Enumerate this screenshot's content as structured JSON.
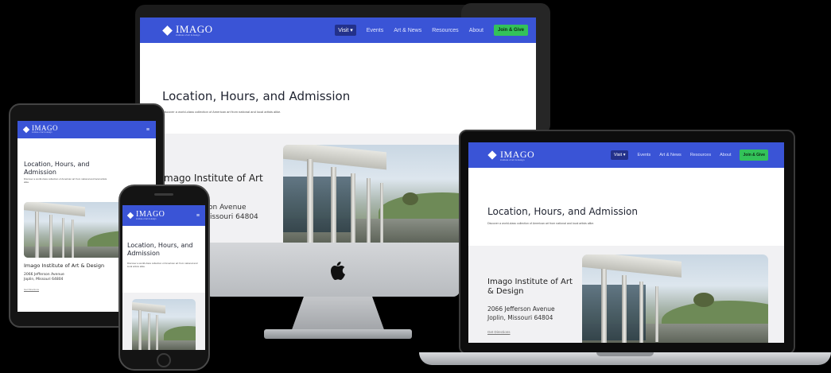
{
  "site": {
    "logo_text": "IMAGO",
    "logo_sub": "institute of art & design",
    "nav": [
      "Visit ▾",
      "Events",
      "Art & News",
      "Resources",
      "About"
    ],
    "cta": "Join & Give",
    "menu_icon": "hamburger-icon",
    "hero_title": "Location, Hours, and Admission",
    "hero_title_wrapped": [
      "Location, Hours, and",
      "Admission"
    ],
    "hero_desc": "Discover a world-class collection of American art from national and local artists alike.",
    "inst_name": "Imago Institute of Art & Design",
    "inst_name_l1": "Imago Institute of Art",
    "inst_name_l2": "& Design",
    "addr_1": "2066 Jefferson Avenue",
    "addr_2": "Joplin, Missouri 64804",
    "addr_2_partial": "issouri 64804",
    "addr_1_partial": "on Avenue",
    "inst_partial": "mago Institute of Art",
    "link": "Get Directions"
  },
  "colors": {
    "brand_blue": "#3a54d6",
    "cta_green": "#33c25a",
    "band": "#f1f1f3"
  },
  "icons": {
    "apple": ""
  }
}
